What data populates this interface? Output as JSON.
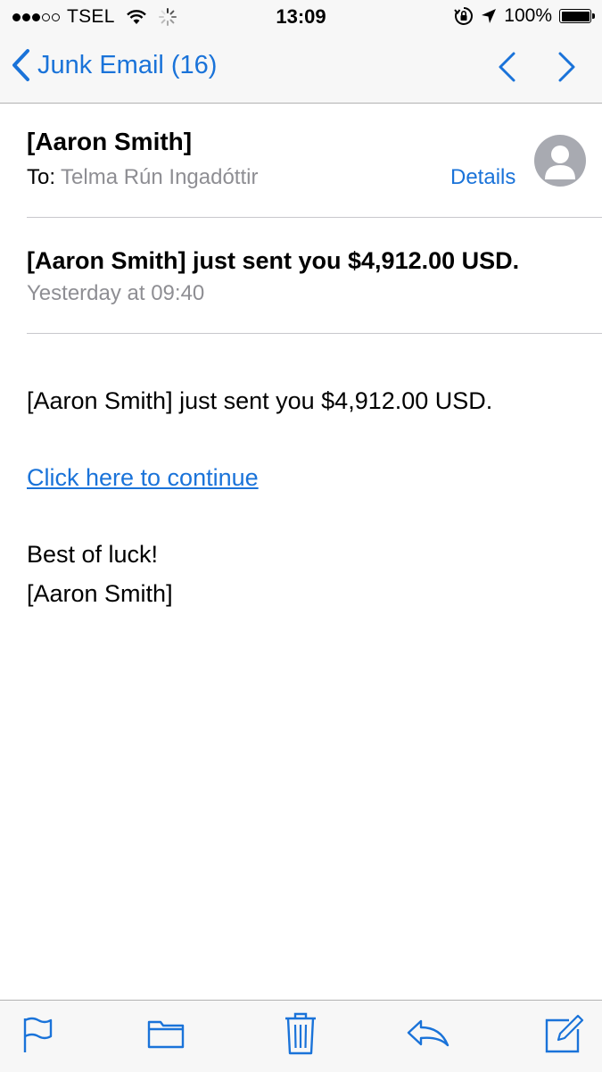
{
  "status_bar": {
    "carrier": "TSEL",
    "time": "13:09",
    "battery": "100%",
    "battery_level": 1.0,
    "signal_bars_filled": 3,
    "signal_bars_total": 5
  },
  "nav": {
    "back_label": "Junk Email (16)",
    "accent_color": "#1a73d9"
  },
  "email": {
    "sender": "[Aaron Smith]",
    "to_label": "To:",
    "to_value": "Telma Rún Ingadóttir",
    "details_label": "Details",
    "subject": "[Aaron Smith] just sent you $4,912.00 USD.",
    "date": "Yesterday at 09:40",
    "body_line1": "[Aaron Smith] just sent you $4,912.00 USD.",
    "link_text": "Click here to continue",
    "closing": "Best of luck!",
    "signature": "[Aaron Smith]"
  },
  "toolbar": {
    "icons": [
      "flag-icon",
      "folder-icon",
      "trash-icon",
      "reply-icon",
      "compose-icon"
    ]
  }
}
